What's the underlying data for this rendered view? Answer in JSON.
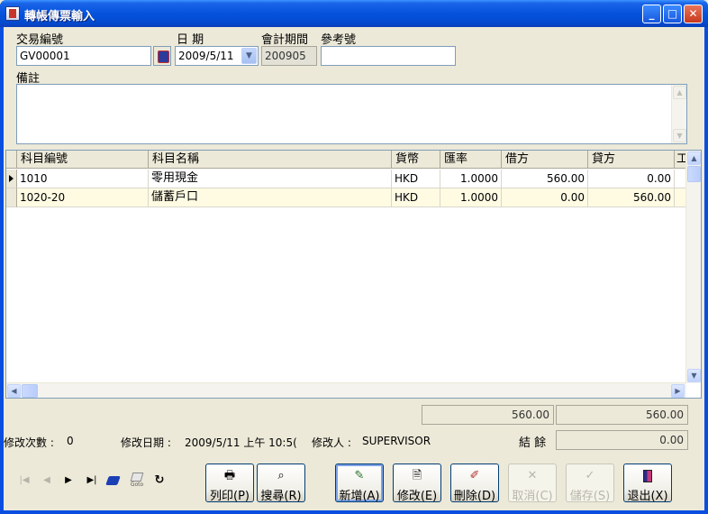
{
  "window": {
    "title": "轉帳傳票輸入",
    "min_glyph": "_",
    "max_glyph": "□",
    "close_glyph": "✕"
  },
  "form": {
    "txn_no_label": "交易編號",
    "txn_no_value": "GV00001",
    "date_label": "日 期",
    "date_value": "2009/5/11",
    "period_label": "會計期間",
    "period_value": "200905",
    "ref_label": "參考號",
    "ref_value": "",
    "memo_label": "備註",
    "memo_value": ""
  },
  "grid": {
    "columns": [
      "科目編號",
      "科目名稱",
      "貨幣",
      "匯率",
      "借方",
      "貸方",
      "工"
    ],
    "rows": [
      {
        "code": "1010",
        "name": "零用現金",
        "currency": "HKD",
        "rate": "1.0000",
        "debit": "560.00",
        "credit": "0.00",
        "current": true
      },
      {
        "code": "1020-20",
        "name": "儲蓄戶口",
        "currency": "HKD",
        "rate": "1.0000",
        "debit": "0.00",
        "credit": "560.00",
        "current": false
      }
    ],
    "colors": {
      "alt_row": "#fffbe3"
    }
  },
  "totals": {
    "debit_total": "560.00",
    "credit_total": "560.00",
    "balance_label": "結 餘",
    "balance_value": "0.00"
  },
  "status": {
    "edit_count_label": "修改次數 :",
    "edit_count_value": "0",
    "edit_date_label": "修改日期 :",
    "edit_date_value": "2009/5/11 上午  10:5(",
    "editor_label": "修改人 :",
    "editor_value": "SUPERVISOR"
  },
  "nav": {
    "first": "|◀",
    "prev": "◀",
    "next": "▶",
    "last": "▶|",
    "goto_label": "Goto",
    "refresh": "↻"
  },
  "buttons": {
    "print": "列印(P)",
    "search": "搜尋(R)",
    "add": "新增(A)",
    "modify": "修改(E)",
    "delete": "刪除(D)",
    "cancel": "取消(C)",
    "save": "儲存(S)",
    "exit": "退出(X)"
  }
}
